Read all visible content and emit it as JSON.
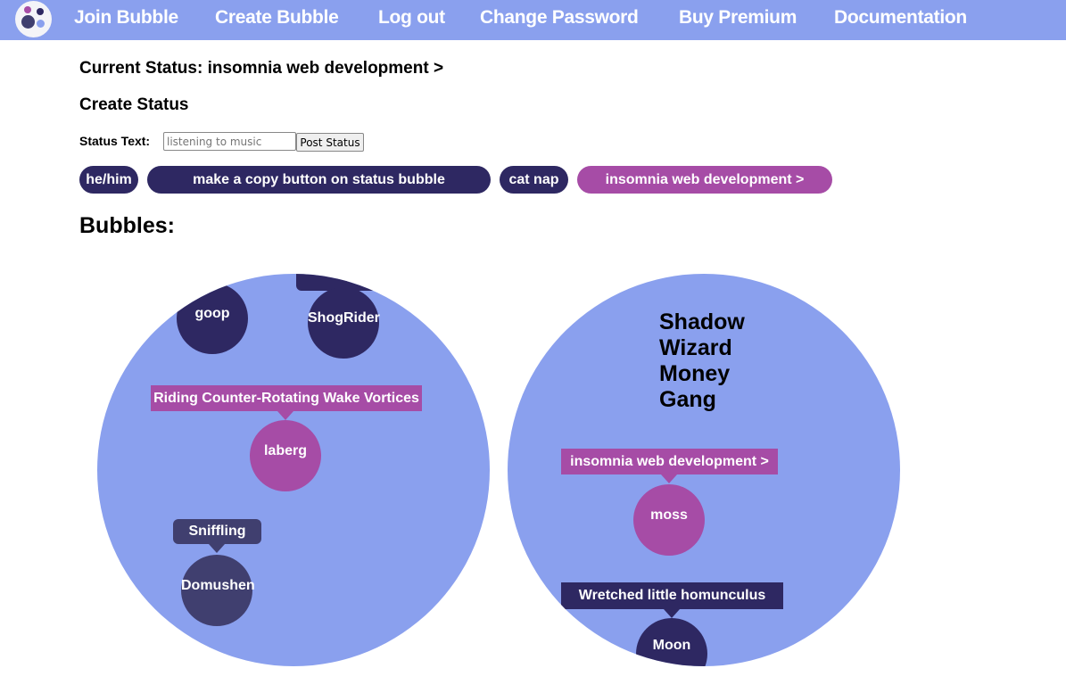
{
  "nav": {
    "logo": "bubble-logo",
    "links": [
      "Join Bubble",
      "Create Bubble",
      "Log out",
      "Change Password",
      "Buy Premium",
      "Documentation"
    ]
  },
  "current_status": "Current Status: insomnia web development >",
  "create_status": "Create Status",
  "form": {
    "label": "Status Text:",
    "placeholder": "listening to music",
    "value": "",
    "button": "Post Status"
  },
  "status_pills": [
    "he/him",
    "make a copy button on status bubble",
    "cat nap",
    "insomnia web development >"
  ],
  "bubbles_heading": "Bubbles:",
  "colors": {
    "nav": "#8aa0ee",
    "dark": "#2e2862",
    "purple": "#a64ca6",
    "gray": "#403f6f"
  },
  "bubbles": [
    {
      "members": [
        {
          "name": "goop"
        },
        {
          "name": "ShogRider",
          "status": ""
        },
        {
          "name": "laberg",
          "status": "Riding Counter-Rotating Wake Vortices"
        },
        {
          "name": "Domushen",
          "status": "Sniffling"
        }
      ]
    },
    {
      "title": "Shadow Wizard Money Gang",
      "members": [
        {
          "name": "moss",
          "status": "insomnia web development >"
        },
        {
          "name": "Moon",
          "status": "Wretched little homunculus"
        }
      ]
    }
  ]
}
